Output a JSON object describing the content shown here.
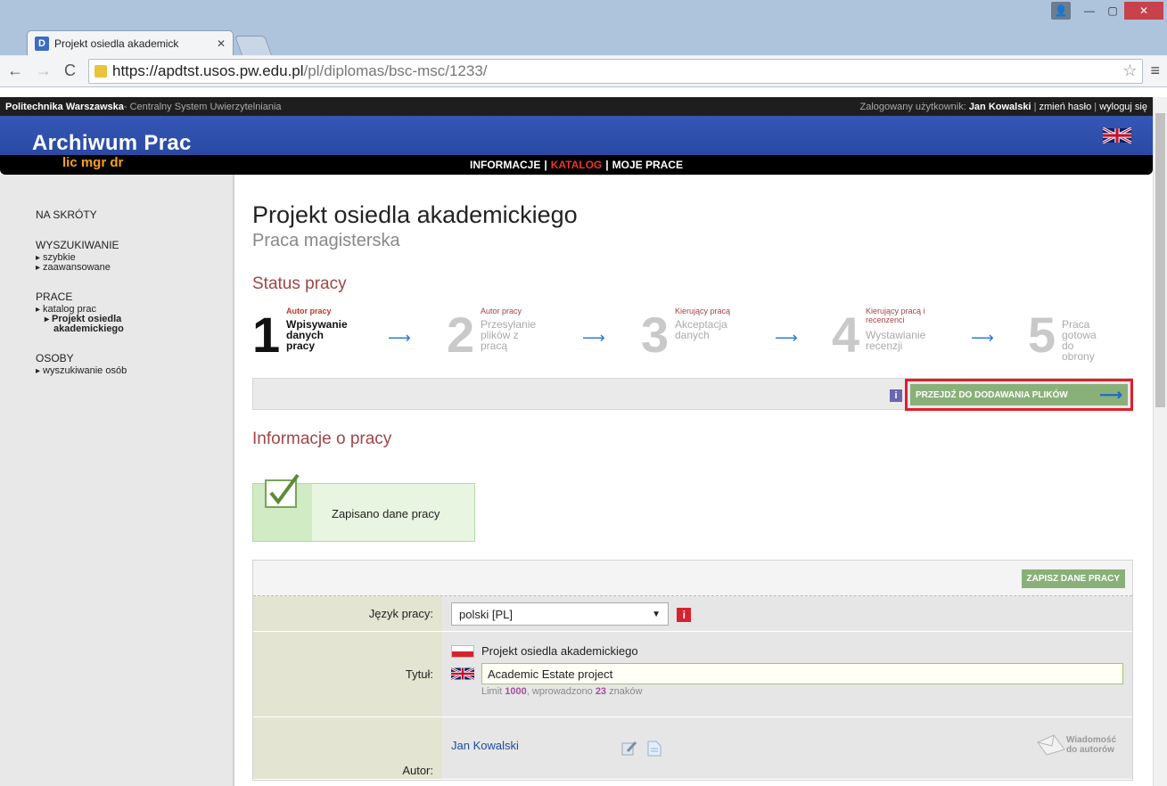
{
  "browser": {
    "tab_title": "Projekt osiedla akademick",
    "favicon_letter": "D",
    "url_domain": "https://apdtst.usos.pw.edu.pl",
    "url_path": "/pl/diplomas/bsc-msc/1233/"
  },
  "topbar": {
    "org": "Politechnika Warszawska",
    "org_sub": " - Centralny System Uwierzytelniania",
    "logged_prefix": "Zalogowany użytkownik: ",
    "user": "Jan Kowalski",
    "change_pw": "zmień hasło",
    "logout": "wyloguj się"
  },
  "banner": {
    "logo": "Archiwum Prac",
    "logo_sub": "lic mgr dr"
  },
  "nav": [
    "INFORMACJE",
    "KATALOG",
    "MOJE PRACE"
  ],
  "sidebar": {
    "shortcuts": "NA SKRÓTY",
    "search_head": "WYSZUKIWANIE",
    "search_items": [
      "szybkie",
      "zaawansowane"
    ],
    "works_head": "PRACE",
    "works_items": [
      "katalog prac"
    ],
    "works_sub": [
      "Projekt osiedla",
      "akademickiego"
    ],
    "people_head": "OSOBY",
    "people_items": [
      "wyszukiwanie osób"
    ]
  },
  "main": {
    "title": "Projekt osiedla akademickiego",
    "subtitle": "Praca magisterska",
    "status_heading": "Status pracy",
    "info_heading": "Informacje o pracy",
    "goto_files": "PRZEJDŹ DO DODAWANIA PLIKÓW",
    "saved_msg": "Zapisano dane pracy",
    "save_btn": "ZAPISZ DANE PRACY"
  },
  "steps": [
    {
      "num": "1",
      "who": "Autor pracy",
      "what": [
        "Wpisywanie",
        "danych",
        "pracy"
      ]
    },
    {
      "num": "2",
      "who": "Autor pracy",
      "what": [
        "Przesyłanie",
        "plików z",
        "pracą"
      ]
    },
    {
      "num": "3",
      "who": "Kierujący pracą",
      "what": [
        "Akceptacja",
        "danych"
      ]
    },
    {
      "num": "4",
      "who": "Kierujący pracą i",
      "who2": "recenzenci",
      "what": [
        "Wystawianie",
        "recenzji"
      ]
    },
    {
      "num": "5",
      "who": "",
      "what": [
        "Praca gotowa",
        "do obrony"
      ]
    }
  ],
  "form": {
    "lang_label": "Język pracy:",
    "lang_value": "polski [PL]",
    "title_label": "Tytuł:",
    "title_pl": "Projekt osiedla akademickiego",
    "title_en": "Academic Estate project",
    "limit_prefix": "Limit ",
    "limit_max": "1000",
    "limit_mid": ", wprowadzono ",
    "limit_count": "23",
    "limit_suffix": " znaków",
    "author_label": "Autor:",
    "author_name": "Jan Kowalski",
    "msg_line1": "Wiadomość",
    "msg_line2": "do autorów"
  },
  "colors": {
    "accent": "#a14545",
    "nav_active": "#e9362e",
    "green_button": "#8ab07a",
    "highlight": "#e21e2a"
  }
}
